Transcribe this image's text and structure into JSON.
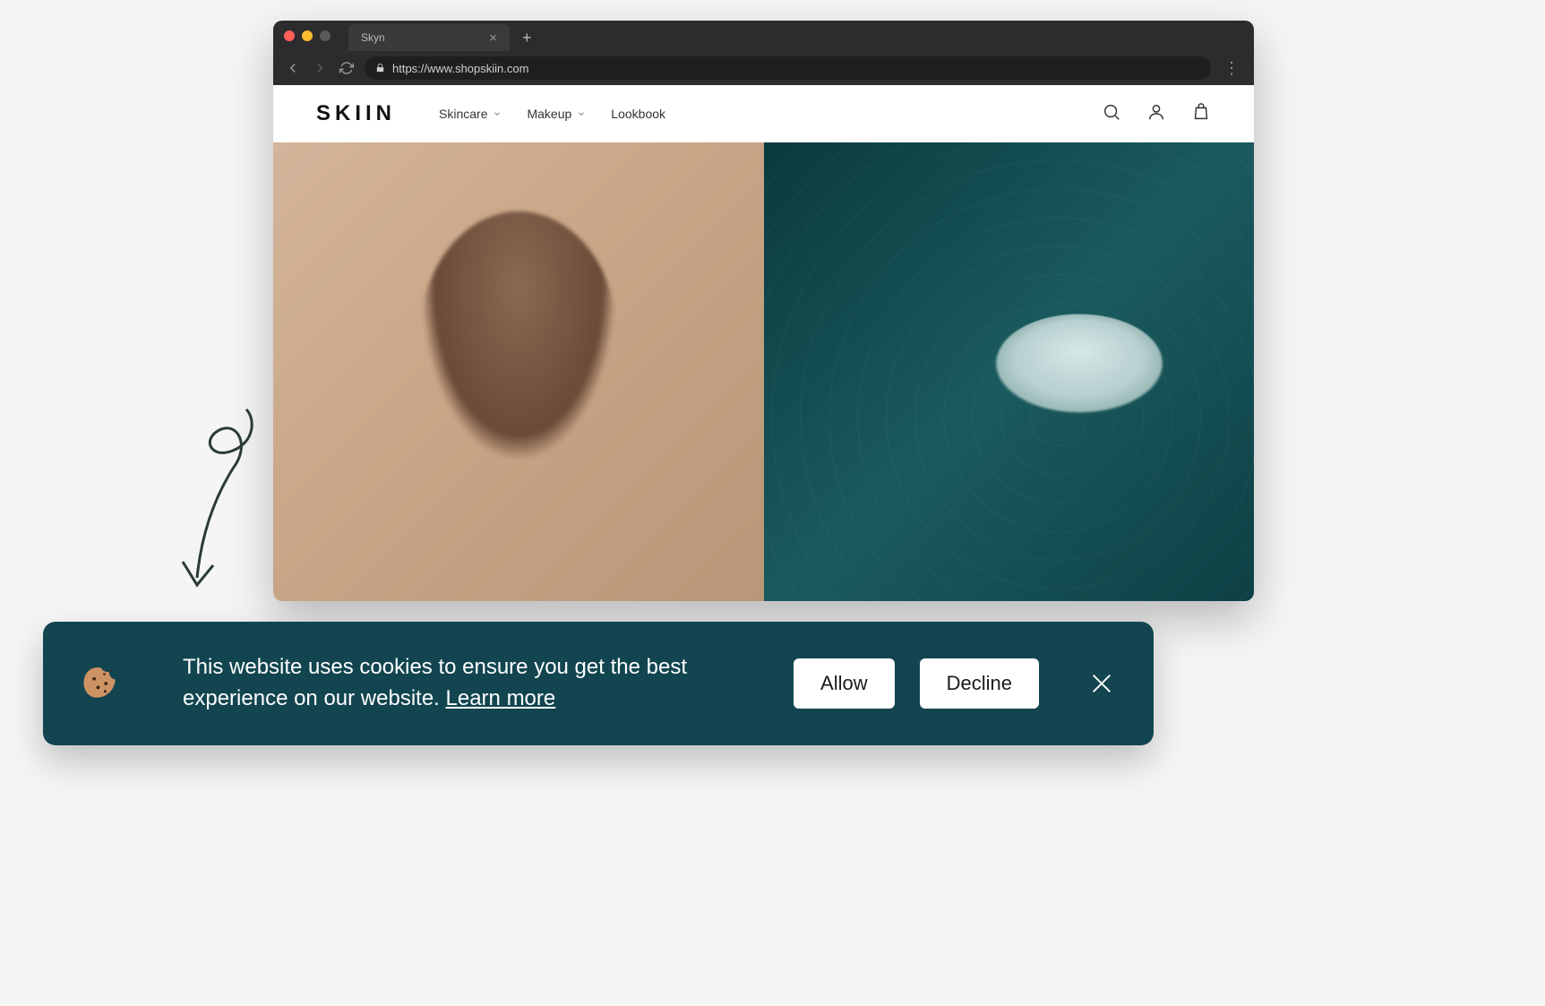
{
  "browser": {
    "tab_title": "Skyn",
    "url": "https://www.shopskiin.com"
  },
  "site": {
    "brand": "SKIIN",
    "nav": [
      {
        "label": "Skincare",
        "has_dropdown": true
      },
      {
        "label": "Makeup",
        "has_dropdown": true
      },
      {
        "label": "Lookbook",
        "has_dropdown": false
      }
    ]
  },
  "cookie_banner": {
    "message_line1": "This website uses cookies to ensure you get the best",
    "message_line2_prefix": "experience on our website. ",
    "learn_more": "Learn more",
    "allow_label": "Allow",
    "decline_label": "Decline"
  }
}
